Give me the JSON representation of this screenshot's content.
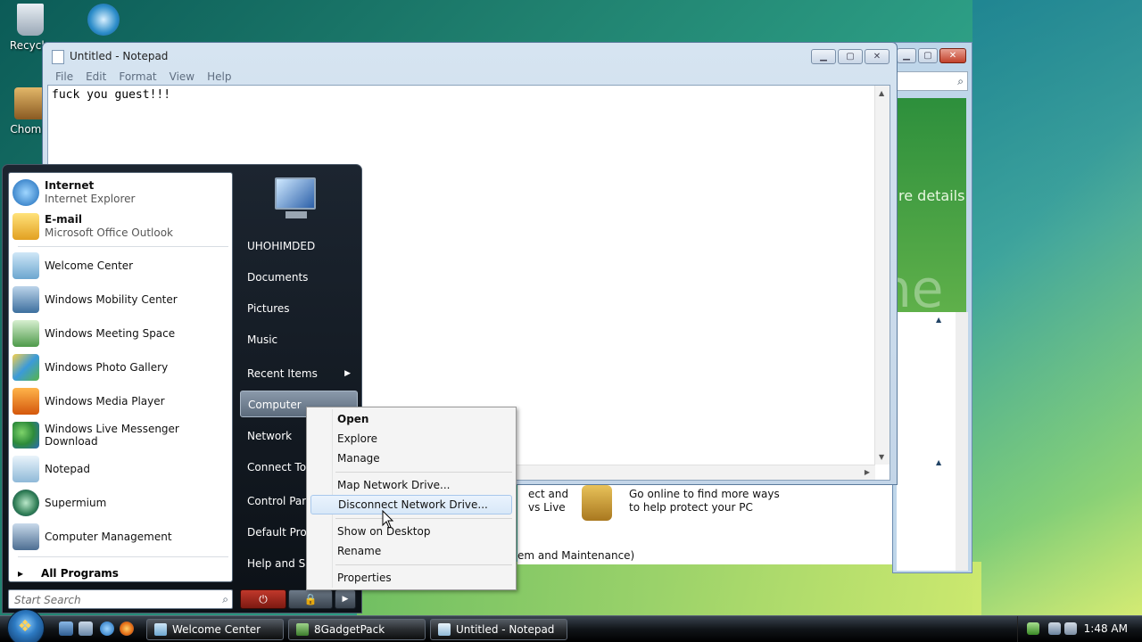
{
  "desktop": {
    "icons": [
      {
        "label": "Recycle",
        "icon": "recycle-bin-icon"
      },
      {
        "label": "Chomik",
        "icon": "chomik-icon"
      }
    ]
  },
  "background_window": {
    "details_text": "re details",
    "logo_text": "ne",
    "peek_text_1a": "ect and",
    "peek_text_1b": "vs Live",
    "security_text_1": "Go online to find more ways",
    "security_text_2": "to help protect your PC",
    "peek_text_2": "em and Maintenance)"
  },
  "notepad": {
    "title": "Untitled - Notepad",
    "menu": [
      "File",
      "Edit",
      "Format",
      "View",
      "Help"
    ],
    "content": "fuck you guest!!!"
  },
  "start_menu": {
    "pinned": [
      {
        "title": "Internet",
        "subtitle": "Internet Explorer",
        "icon": "internet-explorer-icon"
      },
      {
        "title": "E-mail",
        "subtitle": "Microsoft Office Outlook",
        "icon": "outlook-icon"
      }
    ],
    "recent": [
      {
        "label": "Welcome Center",
        "icon": "welcome-center-icon"
      },
      {
        "label": "Windows Mobility Center",
        "icon": "mobility-center-icon"
      },
      {
        "label": "Windows Meeting Space",
        "icon": "meeting-space-icon"
      },
      {
        "label": "Windows Photo Gallery",
        "icon": "photo-gallery-icon"
      },
      {
        "label": "Windows Media Player",
        "icon": "media-player-icon"
      },
      {
        "label": "Windows Live Messenger Download",
        "icon": "messenger-icon"
      },
      {
        "label": "Notepad",
        "icon": "notepad-icon"
      },
      {
        "label": "Supermium",
        "icon": "supermium-icon"
      },
      {
        "label": "Computer Management",
        "icon": "computer-management-icon"
      }
    ],
    "all_programs": "All Programs",
    "search_placeholder": "Start Search",
    "right": [
      {
        "label": "UHOHIMDED"
      },
      {
        "label": "Documents"
      },
      {
        "label": "Pictures"
      },
      {
        "label": "Music"
      },
      {
        "label": "Recent Items"
      },
      {
        "label": "Computer"
      },
      {
        "label": "Network"
      },
      {
        "label": "Connect To"
      },
      {
        "label": "Control Panel"
      },
      {
        "label": "Default Programs"
      },
      {
        "label": "Help and Support"
      }
    ]
  },
  "context_menu": {
    "items": [
      "Open",
      "Explore",
      "Manage",
      "Map Network Drive...",
      "Disconnect Network Drive...",
      "Show on Desktop",
      "Rename",
      "Properties"
    ]
  },
  "taskbar": {
    "buttons": [
      "Welcome Center",
      "8GadgetPack",
      "Untitled - Notepad"
    ],
    "clock": "1:48 AM"
  },
  "colors": {
    "accent": "#2d7ac2",
    "context_highlight": "#d8e8f8"
  }
}
